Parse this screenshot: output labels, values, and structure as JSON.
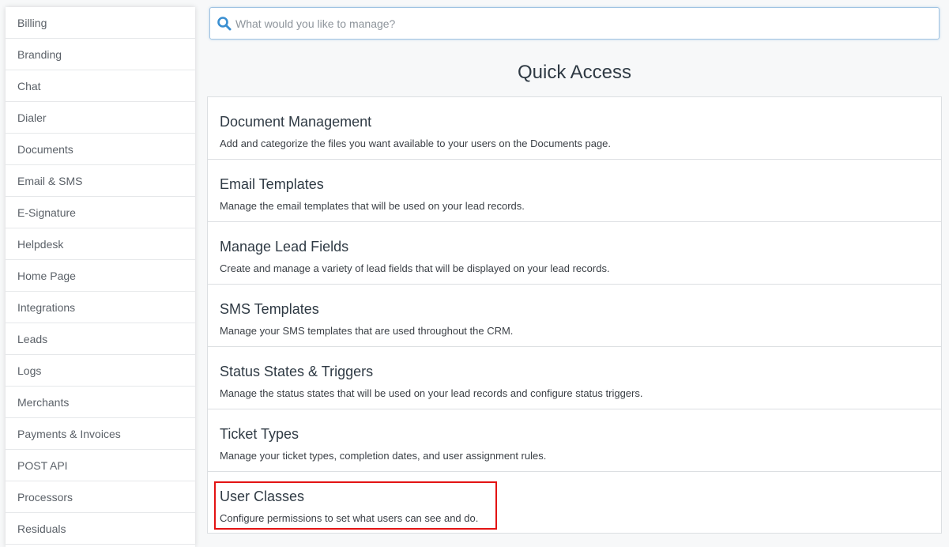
{
  "sidebar": {
    "items": [
      {
        "label": "Billing"
      },
      {
        "label": "Branding"
      },
      {
        "label": "Chat"
      },
      {
        "label": "Dialer"
      },
      {
        "label": "Documents"
      },
      {
        "label": "Email & SMS"
      },
      {
        "label": "E-Signature"
      },
      {
        "label": "Helpdesk"
      },
      {
        "label": "Home Page"
      },
      {
        "label": "Integrations"
      },
      {
        "label": "Leads"
      },
      {
        "label": "Logs"
      },
      {
        "label": "Merchants"
      },
      {
        "label": "Payments & Invoices"
      },
      {
        "label": "POST API"
      },
      {
        "label": "Processors"
      },
      {
        "label": "Residuals"
      }
    ]
  },
  "search": {
    "placeholder": "What would you like to manage?",
    "value": "",
    "icon": "search-icon"
  },
  "main": {
    "title": "Quick Access",
    "items": [
      {
        "title": "Document Management",
        "description": "Add and categorize the files you want available to your users on the Documents page."
      },
      {
        "title": "Email Templates",
        "description": "Manage the email templates that will be used on your lead records."
      },
      {
        "title": "Manage Lead Fields",
        "description": "Create and manage a variety of lead fields that will be displayed on your lead records."
      },
      {
        "title": "SMS Templates",
        "description": "Manage your SMS templates that are used throughout the CRM."
      },
      {
        "title": "Status States & Triggers",
        "description": "Manage the status states that will be used on your lead records and configure status triggers."
      },
      {
        "title": "Ticket Types",
        "description": "Manage your ticket types, completion dates, and user assignment rules."
      },
      {
        "title": "User Classes",
        "description": "Configure permissions to set what users can see and do."
      }
    ]
  },
  "colors": {
    "accent": "#3a8fd1",
    "highlight": "#e31313",
    "background": "#f7f8f9"
  }
}
